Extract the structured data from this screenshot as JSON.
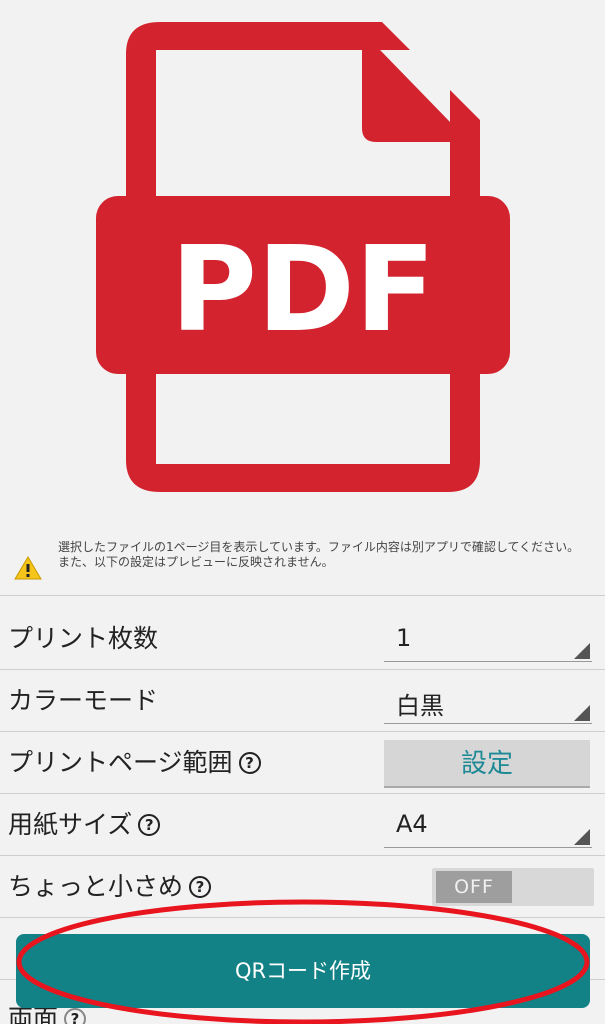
{
  "preview": {
    "badge_text": "PDF"
  },
  "notice": {
    "line1": "選択したファイルの1ページ目を表示しています。ファイル内容は別アプリで確認してください。",
    "line2": "また、以下の設定はプレビューに反映されません。"
  },
  "settings": {
    "copies": {
      "label": "プリント枚数",
      "value": "1"
    },
    "color_mode": {
      "label": "カラーモード",
      "value": "白黒"
    },
    "page_range": {
      "label": "プリントページ範囲",
      "button": "設定"
    },
    "paper_size": {
      "label": "用紙サイズ",
      "value": "A4"
    },
    "shrink": {
      "label": "ちょっと小さめ",
      "state": "OFF"
    },
    "duplex": {
      "label": "両面"
    }
  },
  "help_glyph": "?",
  "qr_button": {
    "label": "QRコード作成"
  },
  "colors": {
    "pdf_red": "#d2232e",
    "accent_teal": "#138287",
    "annotation_red": "#e8141e"
  }
}
